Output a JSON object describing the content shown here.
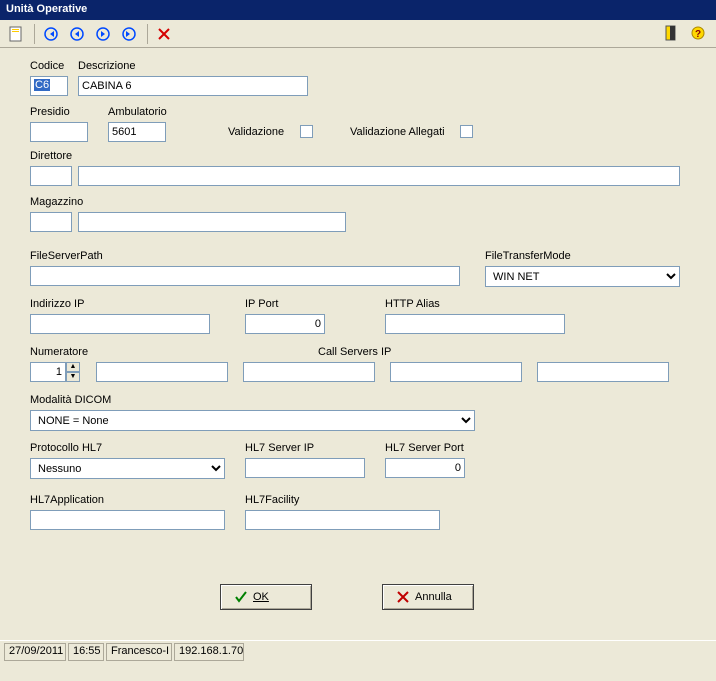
{
  "window": {
    "title": "Unità Operative"
  },
  "labels": {
    "codice": "Codice",
    "descrizione": "Descrizione",
    "presidio": "Presidio",
    "ambulatorio": "Ambulatorio",
    "validazione": "Validazione",
    "validazione_allegati": "Validazione Allegati",
    "direttore": "Direttore",
    "magazzino": "Magazzino",
    "fileserverpath": "FileServerPath",
    "filetransfermode": "FileTransferMode",
    "indirizzo_ip": "Indirizzo IP",
    "ip_port": "IP Port",
    "http_alias": "HTTP Alias",
    "numeratore": "Numeratore",
    "call_servers_ip": "Call Servers  IP",
    "modalita_dicom": "Modalità DICOM",
    "protocollo_hl7": "Protocollo HL7",
    "hl7_server_ip": "HL7 Server IP",
    "hl7_server_port": "HL7 Server Port",
    "hl7application": "HL7Application",
    "hl7facility": "HL7Facility"
  },
  "values": {
    "codice": "C6",
    "descrizione": "CABINA 6",
    "presidio": "",
    "ambulatorio": "5601",
    "direttore_code": "",
    "direttore_name": "",
    "magazzino_code": "",
    "magazzino_name": "",
    "fileserverpath": "",
    "filetransfermode": "WIN NET",
    "indirizzo_ip": "",
    "ip_port": "0",
    "http_alias": "",
    "numeratore": "1",
    "call_server_1": "",
    "call_server_2": "",
    "call_server_3": "",
    "call_server_4": "",
    "modalita_dicom": "NONE = None",
    "protocollo_hl7": "Nessuno",
    "hl7_server_ip": "",
    "hl7_server_port": "0",
    "hl7application": "",
    "hl7facility": ""
  },
  "checks": {
    "validazione": false,
    "validazione_allegati": false
  },
  "buttons": {
    "ok": "OK",
    "annulla": "Annulla"
  },
  "statusbar": {
    "date": "27/09/2011",
    "time": "16:55",
    "user": "Francesco-I",
    "host": "192.168.1.70"
  }
}
